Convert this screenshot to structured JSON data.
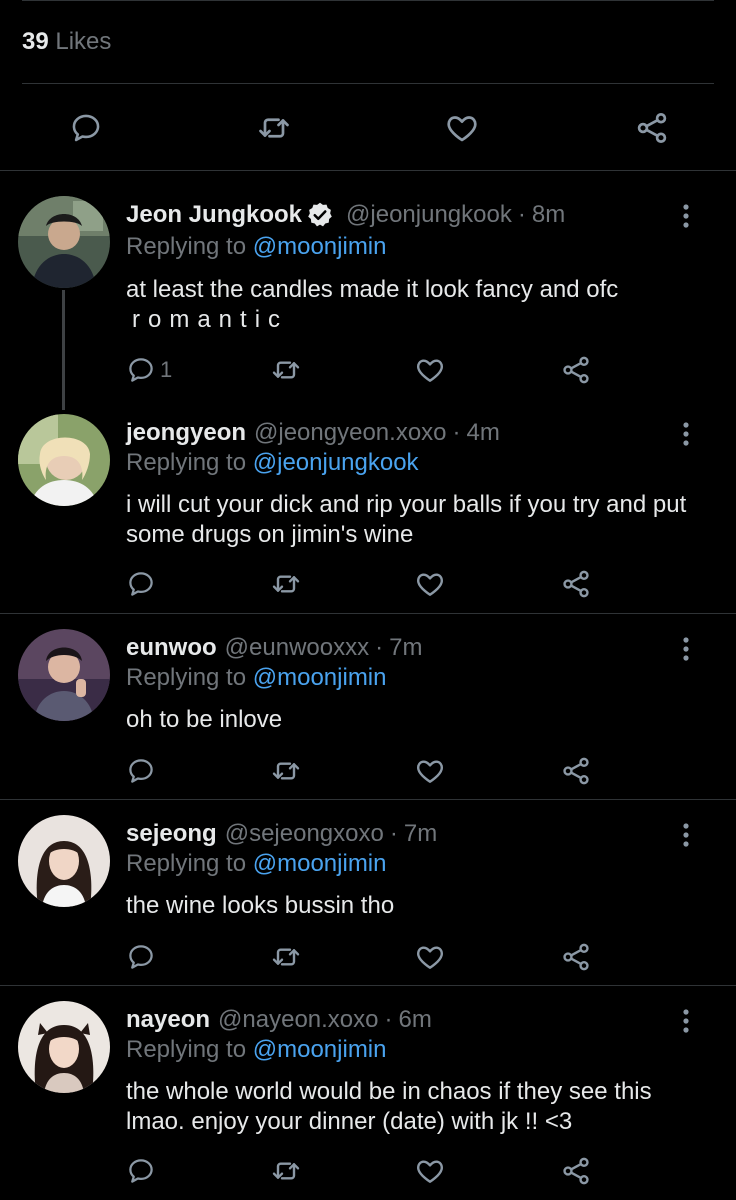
{
  "header": {
    "likes_count": "39",
    "likes_label": "Likes"
  },
  "colors": {
    "background": "#000000",
    "text": "#e7e9ea",
    "muted": "#71767b",
    "link": "#4aa3ef",
    "divider": "#2f3336"
  },
  "icons": {
    "reply": "reply-icon",
    "retweet": "retweet-icon",
    "like": "heart-icon",
    "share": "share-icon",
    "more": "more-vertical-icon",
    "verified": "verified-badge-icon"
  },
  "replies": [
    {
      "name": "Jeon Jungkook",
      "handle": "@jeonjungkook",
      "sep": "·",
      "time": "8m",
      "replying_label": "Replying to",
      "replying_to": "@moonjimin",
      "text_line1": "at least the candles made it look fancy and ofc",
      "text_line2": "romantic",
      "reply_count": "1",
      "verified": true
    },
    {
      "name": "jeongyeon",
      "handle": "@jeongyeon.xoxo",
      "sep": "·",
      "time": "4m",
      "replying_label": "Replying to",
      "replying_to": "@jeonjungkook",
      "text": "i will cut your dick and rip your balls if you try and put some drugs on jimin's wine",
      "reply_count": ""
    },
    {
      "name": "eunwoo",
      "handle": "@eunwooxxx",
      "sep": "·",
      "time": "7m",
      "replying_label": "Replying to",
      "replying_to": "@moonjimin",
      "text": "oh to be inlove",
      "reply_count": ""
    },
    {
      "name": "sejeong",
      "handle": "@sejeongxoxo",
      "sep": "·",
      "time": "7m",
      "replying_label": "Replying to",
      "replying_to": "@moonjimin",
      "text": "the wine looks bussin tho",
      "reply_count": ""
    },
    {
      "name": "nayeon",
      "handle": "@nayeon.xoxo",
      "sep": "·",
      "time": "6m",
      "replying_label": "Replying to",
      "replying_to": "@moonjimin",
      "text": "the whole world would be in chaos if they see this lmao. enjoy your dinner (date) with jk !! <3",
      "reply_count": ""
    }
  ]
}
